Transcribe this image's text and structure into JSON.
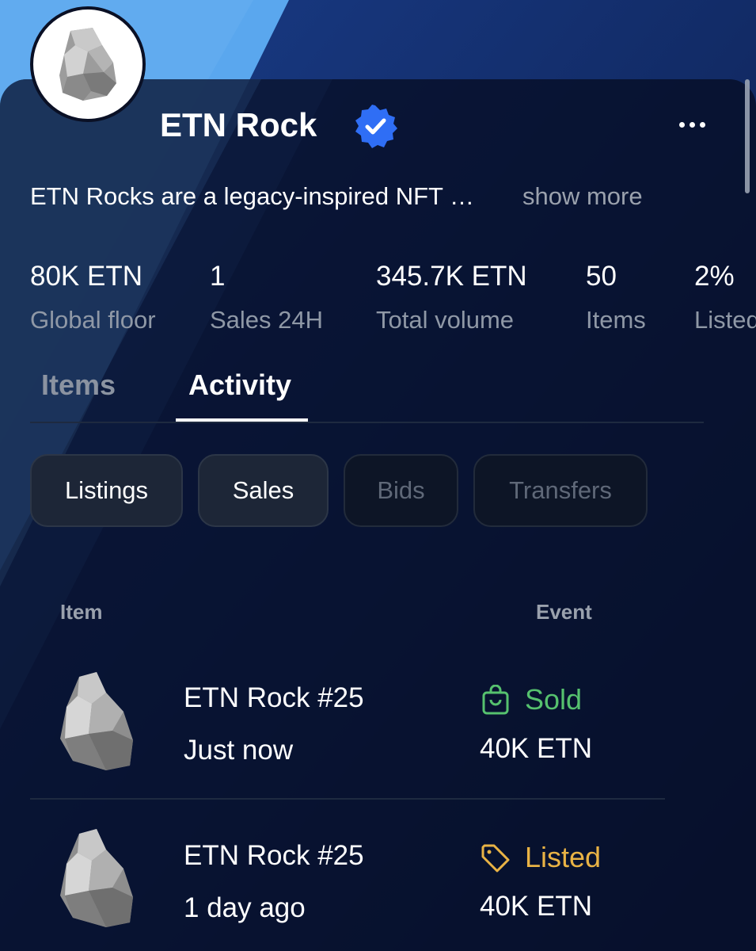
{
  "collection": {
    "name": "ETN Rock",
    "verified": true,
    "description": "ETN Rocks are a legacy-inspired NFT …",
    "show_more_label": "show more"
  },
  "stats": [
    {
      "value": "80K ETN",
      "label": "Global floor"
    },
    {
      "value": "1",
      "label": "Sales 24H"
    },
    {
      "value": "345.7K ETN",
      "label": "Total volume"
    },
    {
      "value": "50",
      "label": "Items"
    },
    {
      "value": "2%",
      "label": "Listed"
    }
  ],
  "tabs": {
    "items": "Items",
    "activity": "Activity",
    "active": "Activity"
  },
  "filters": [
    {
      "label": "Listings",
      "selected": true
    },
    {
      "label": "Sales",
      "selected": true
    },
    {
      "label": "Bids",
      "selected": false
    },
    {
      "label": "Transfers",
      "selected": false
    }
  ],
  "table": {
    "headers": {
      "item": "Item",
      "event": "Event"
    },
    "rows": [
      {
        "name": "ETN Rock #25",
        "time": "Just now",
        "event": "Sold",
        "event_icon": "shopping-bag-icon",
        "price": "40K ETN"
      },
      {
        "name": "ETN Rock #25",
        "time": "1 day ago",
        "event": "Listed",
        "event_icon": "tag-icon",
        "price": "40K ETN"
      }
    ]
  },
  "colors": {
    "background": "#0a1530",
    "banner_light": "#5aa7ee",
    "verified": "#2f6ef5",
    "sold": "#56c16e",
    "listed": "#e9b345",
    "muted_text": "#8f98a6"
  }
}
